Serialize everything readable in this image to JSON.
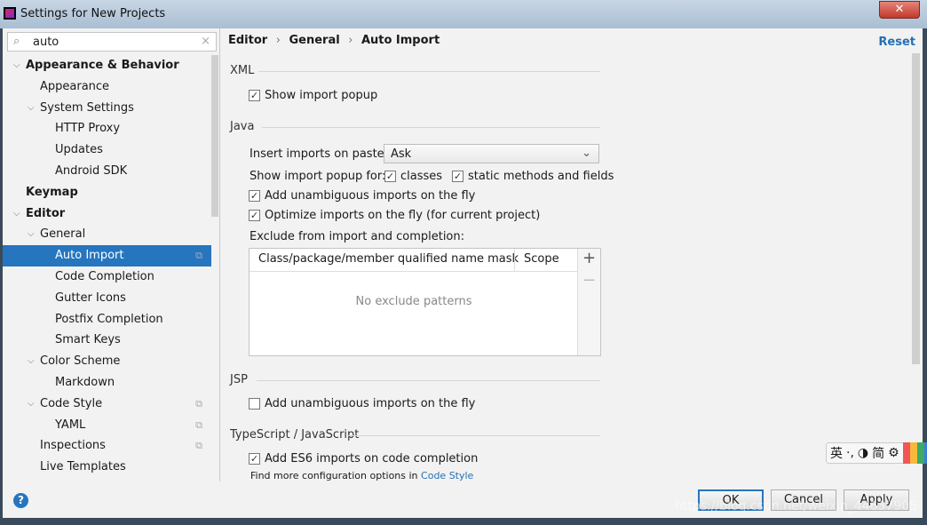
{
  "window": {
    "title": "Settings for New Projects",
    "close": "✕"
  },
  "search": {
    "value": "auto",
    "icon": "search-icon",
    "clear": "×"
  },
  "tree": [
    {
      "label": "Appearance & Behavior",
      "level": 0,
      "bold": true,
      "expanded": true
    },
    {
      "label": "Appearance",
      "level": 1
    },
    {
      "label": "System Settings",
      "level": 1,
      "expanded": true
    },
    {
      "label": "HTTP Proxy",
      "level": 2
    },
    {
      "label": "Updates",
      "level": 2
    },
    {
      "label": "Android SDK",
      "level": 2
    },
    {
      "label": "Keymap",
      "level": 0,
      "bold": true
    },
    {
      "label": "Editor",
      "level": 0,
      "bold": true,
      "expanded": true
    },
    {
      "label": "General",
      "level": 1,
      "expanded": true
    },
    {
      "label": "Auto Import",
      "level": 2,
      "selected": true,
      "copy": true
    },
    {
      "label": "Code Completion",
      "level": 2
    },
    {
      "label": "Gutter Icons",
      "level": 2
    },
    {
      "label": "Postfix Completion",
      "level": 2
    },
    {
      "label": "Smart Keys",
      "level": 2
    },
    {
      "label": "Color Scheme",
      "level": 1,
      "expanded": true
    },
    {
      "label": "Markdown",
      "level": 2
    },
    {
      "label": "Code Style",
      "level": 1,
      "expanded": true,
      "copy": true
    },
    {
      "label": "YAML",
      "level": 2,
      "copy": true
    },
    {
      "label": "Inspections",
      "level": 1,
      "copy": true
    },
    {
      "label": "Live Templates",
      "level": 1
    }
  ],
  "breadcrumb": {
    "a": "Editor",
    "b": "General",
    "c": "Auto Import",
    "sep": "›"
  },
  "reset": "Reset",
  "xml": {
    "title": "XML",
    "show_popup": "Show import popup",
    "show_popup_checked": true
  },
  "java": {
    "title": "Java",
    "insert_label": "Insert imports on paste:",
    "insert_value": "Ask",
    "popup_for": "Show import popup for:",
    "classes": "classes",
    "classes_checked": true,
    "static": "static methods and fields",
    "static_checked": true,
    "unambiguous": "Add unambiguous imports on the fly",
    "unambiguous_checked": true,
    "optimize": "Optimize imports on the fly (for current project)",
    "optimize_checked": true,
    "exclude": "Exclude from import and completion:",
    "col1": "Class/package/member qualified name mask",
    "col2": "Scope",
    "empty": "No exclude patterns",
    "add": "+",
    "remove": "−"
  },
  "jsp": {
    "title": "JSP",
    "unambiguous": "Add unambiguous imports on the fly",
    "unambiguous_checked": false
  },
  "ts": {
    "title": "TypeScript / JavaScript",
    "es6": "Add ES6 imports on code completion",
    "es6_checked": true,
    "more": "Find more configuration options in",
    "link": "Code Style"
  },
  "buttons": {
    "ok": "OK",
    "cancel": "Cancel",
    "apply": "Apply",
    "help": "?"
  },
  "ime": {
    "a": "英",
    "b": "·,",
    "c": "◑",
    "d": "简",
    "e": "⚙"
  },
  "watermark": "https://blog.csdn.net/weixin_44637905",
  "colors": {
    "accent": "#2675bf",
    "link": "#2470b3"
  }
}
